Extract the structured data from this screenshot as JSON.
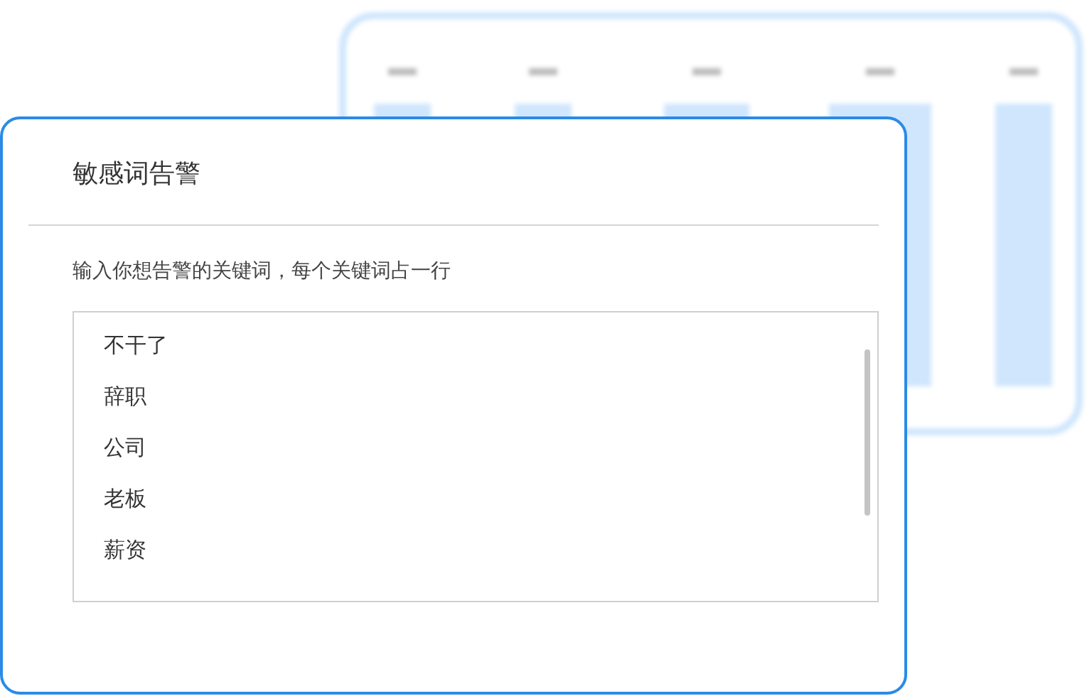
{
  "dialog": {
    "title": "敏感词告警",
    "instruction": "输入你想告警的关键词，每个关键词占一行",
    "keywords": [
      "不干了",
      "辞职",
      "公司",
      "老板",
      "薪资"
    ]
  }
}
